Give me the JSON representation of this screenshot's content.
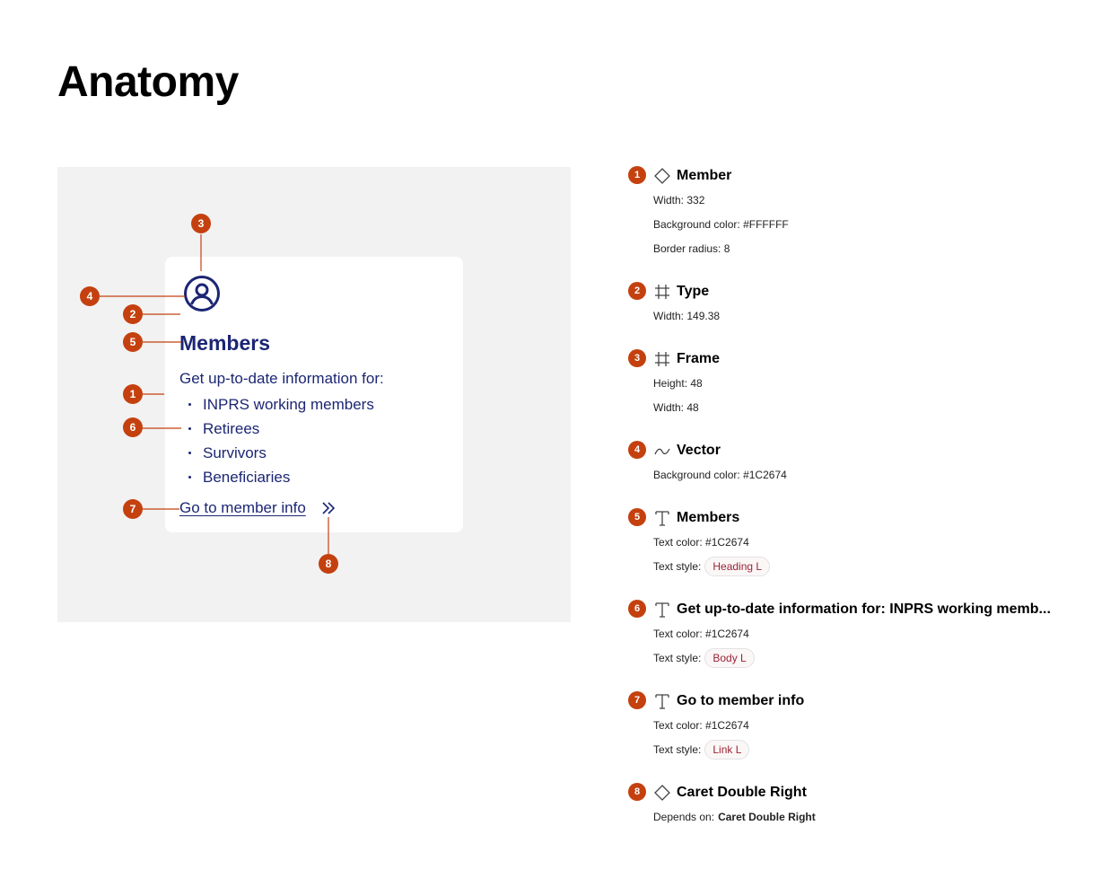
{
  "page": {
    "title": "Anatomy"
  },
  "card": {
    "heading": "Members",
    "intro": "Get up-to-date information for:",
    "list": [
      "INPRS working members",
      "Retirees",
      "Survivors",
      "Beneficiaries"
    ],
    "link": "Go to member info",
    "icon": "user-circle-icon",
    "caret_icon": "caret-double-right-icon"
  },
  "markers": [
    {
      "n": "1",
      "target": "card-body"
    },
    {
      "n": "2",
      "target": "type-frame"
    },
    {
      "n": "3",
      "target": "icon-frame"
    },
    {
      "n": "4",
      "target": "icon-vector"
    },
    {
      "n": "5",
      "target": "heading"
    },
    {
      "n": "6",
      "target": "body-text"
    },
    {
      "n": "7",
      "target": "link"
    },
    {
      "n": "8",
      "target": "caret"
    }
  ],
  "specs": [
    {
      "num": "1",
      "icon": "component-diamond-icon",
      "name": "Member",
      "props": [
        {
          "label": "Width:",
          "value": "332"
        },
        {
          "label": "Background color:",
          "value": "#FFFFFF"
        },
        {
          "label": "Border radius:",
          "value": "8"
        }
      ]
    },
    {
      "num": "2",
      "icon": "frame-hash-icon",
      "name": "Type",
      "props": [
        {
          "label": "Width:",
          "value": "149.38"
        }
      ]
    },
    {
      "num": "3",
      "icon": "frame-hash-icon",
      "name": "Frame",
      "props": [
        {
          "label": "Height:",
          "value": "48"
        },
        {
          "label": "Width:",
          "value": "48"
        }
      ]
    },
    {
      "num": "4",
      "icon": "vector-curve-icon",
      "name": "Vector",
      "props": [
        {
          "label": "Background color:",
          "value": "#1C2674"
        }
      ]
    },
    {
      "num": "5",
      "icon": "text-t-icon",
      "name": "Members",
      "props": [
        {
          "label": "Text color:",
          "value": "#1C2674"
        },
        {
          "label": "Text style:",
          "pill": "Heading L"
        }
      ]
    },
    {
      "num": "6",
      "icon": "text-t-icon",
      "name": "Get up-to-date information for: INPRS working memb...",
      "props": [
        {
          "label": "Text color:",
          "value": "#1C2674"
        },
        {
          "label": "Text style:",
          "pill": "Body L"
        }
      ]
    },
    {
      "num": "7",
      "icon": "text-t-icon",
      "name": "Go to member info",
      "props": [
        {
          "label": "Text color:",
          "value": "#1C2674"
        },
        {
          "label": "Text style:",
          "pill": "Link L"
        }
      ]
    },
    {
      "num": "8",
      "icon": "component-diamond-icon",
      "name": "Caret Double Right",
      "props": [
        {
          "label": "Depends on:",
          "bold": "Caret Double Right"
        }
      ]
    }
  ],
  "colors": {
    "badge": "#C4410F",
    "brand": "#1C2674",
    "stage": "#F2F2F2",
    "pill_text": "#9B2335"
  }
}
